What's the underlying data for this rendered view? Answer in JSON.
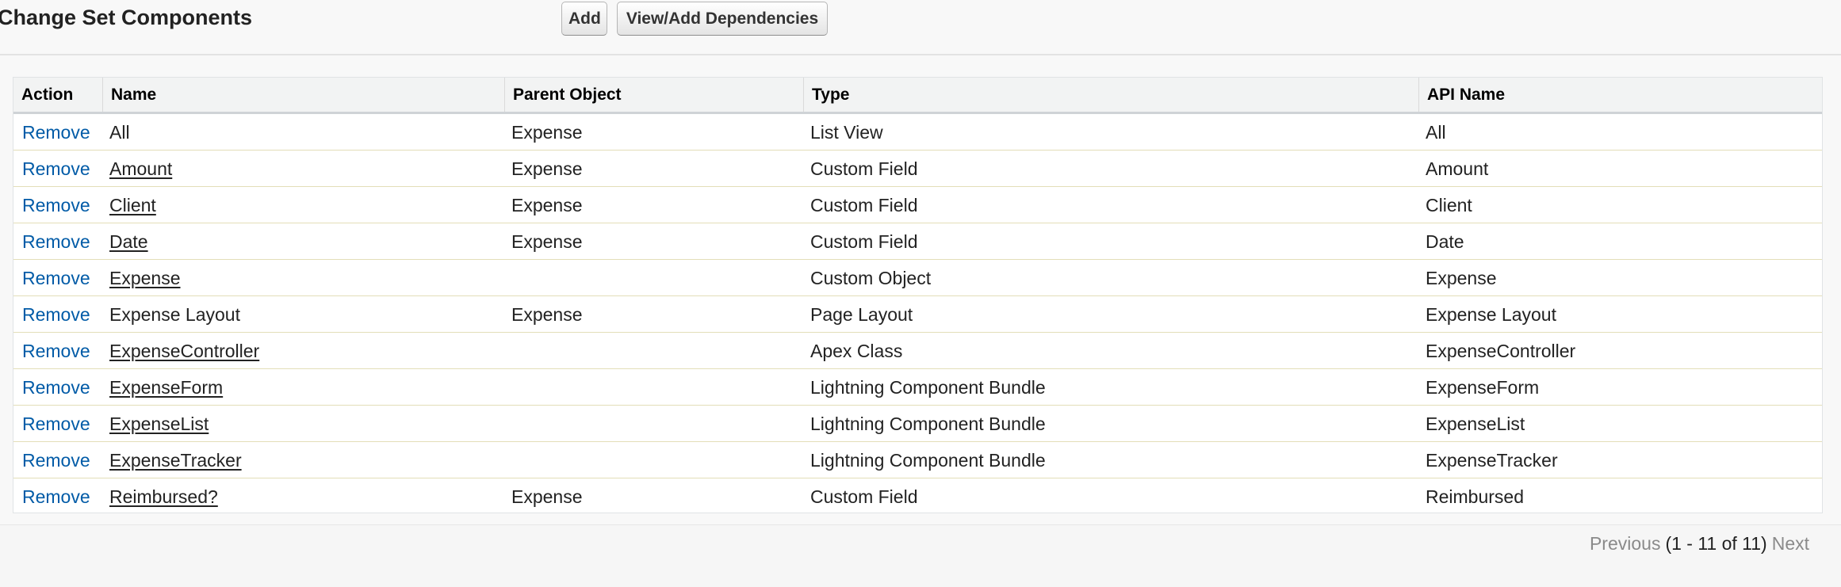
{
  "header": {
    "title": "Change Set Components",
    "add_label": "Add",
    "dependencies_label": "View/Add Dependencies"
  },
  "table": {
    "columns": [
      "Action",
      "Name",
      "Parent Object",
      "Type",
      "API Name"
    ],
    "rows": [
      {
        "action": "Remove",
        "name": "All",
        "name_is_link": false,
        "parent": "Expense",
        "type": "List View",
        "api": "All"
      },
      {
        "action": "Remove",
        "name": "Amount",
        "name_is_link": true,
        "parent": "Expense",
        "type": "Custom Field",
        "api": "Amount"
      },
      {
        "action": "Remove",
        "name": "Client",
        "name_is_link": true,
        "parent": "Expense",
        "type": "Custom Field",
        "api": "Client"
      },
      {
        "action": "Remove",
        "name": "Date",
        "name_is_link": true,
        "parent": "Expense",
        "type": "Custom Field",
        "api": "Date"
      },
      {
        "action": "Remove",
        "name": "Expense",
        "name_is_link": true,
        "parent": "",
        "type": "Custom Object",
        "api": "Expense"
      },
      {
        "action": "Remove",
        "name": "Expense Layout",
        "name_is_link": false,
        "parent": "Expense",
        "type": "Page Layout",
        "api": "Expense Layout"
      },
      {
        "action": "Remove",
        "name": "ExpenseController",
        "name_is_link": true,
        "parent": "",
        "type": "Apex Class",
        "api": "ExpenseController"
      },
      {
        "action": "Remove",
        "name": "ExpenseForm",
        "name_is_link": true,
        "parent": "",
        "type": "Lightning Component Bundle",
        "api": "ExpenseForm"
      },
      {
        "action": "Remove",
        "name": "ExpenseList",
        "name_is_link": true,
        "parent": "",
        "type": "Lightning Component Bundle",
        "api": "ExpenseList"
      },
      {
        "action": "Remove",
        "name": "ExpenseTracker",
        "name_is_link": true,
        "parent": "",
        "type": "Lightning Component Bundle",
        "api": "ExpenseTracker"
      },
      {
        "action": "Remove",
        "name": "Reimbursed?",
        "name_is_link": true,
        "parent": "Expense",
        "type": "Custom Field",
        "api": "Reimbursed"
      }
    ]
  },
  "pagination": {
    "previous_label": "Previous",
    "count_text": "(1 - 11 of 11)",
    "next_label": "Next"
  },
  "colors": {
    "link": "#015ba7",
    "row_divider": "#e3deb8",
    "header_bg": "#f2f3f3"
  }
}
